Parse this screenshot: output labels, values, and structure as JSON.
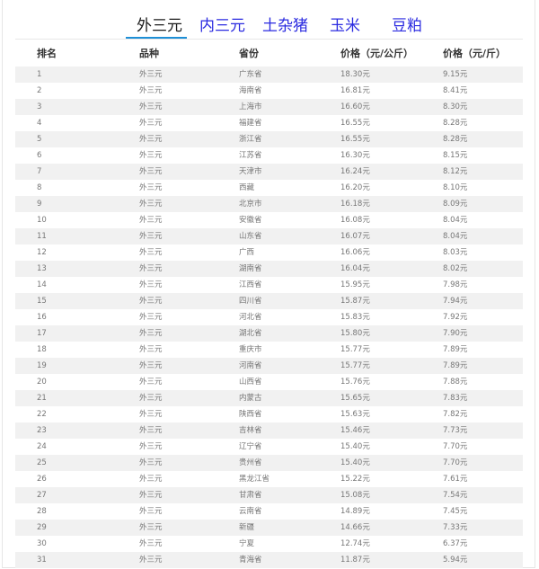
{
  "tabs": [
    {
      "label": "外三元",
      "active": true
    },
    {
      "label": "内三元",
      "active": false
    },
    {
      "label": "土杂猪",
      "active": false
    },
    {
      "label": "玉米",
      "active": false
    },
    {
      "label": "豆粕",
      "active": false
    }
  ],
  "table": {
    "headers": [
      "排名",
      "品种",
      "省份",
      "价格（元/公斤）",
      "价格（元/斤）"
    ],
    "rows": [
      [
        "1",
        "外三元",
        "广东省",
        "18.30元",
        "9.15元"
      ],
      [
        "2",
        "外三元",
        "海南省",
        "16.81元",
        "8.41元"
      ],
      [
        "3",
        "外三元",
        "上海市",
        "16.60元",
        "8.30元"
      ],
      [
        "4",
        "外三元",
        "福建省",
        "16.55元",
        "8.28元"
      ],
      [
        "5",
        "外三元",
        "浙江省",
        "16.55元",
        "8.28元"
      ],
      [
        "6",
        "外三元",
        "江苏省",
        "16.30元",
        "8.15元"
      ],
      [
        "7",
        "外三元",
        "天津市",
        "16.24元",
        "8.12元"
      ],
      [
        "8",
        "外三元",
        "西藏",
        "16.20元",
        "8.10元"
      ],
      [
        "9",
        "外三元",
        "北京市",
        "16.18元",
        "8.09元"
      ],
      [
        "10",
        "外三元",
        "安徽省",
        "16.08元",
        "8.04元"
      ],
      [
        "11",
        "外三元",
        "山东省",
        "16.07元",
        "8.04元"
      ],
      [
        "12",
        "外三元",
        "广西",
        "16.06元",
        "8.03元"
      ],
      [
        "13",
        "外三元",
        "湖南省",
        "16.04元",
        "8.02元"
      ],
      [
        "14",
        "外三元",
        "江西省",
        "15.95元",
        "7.98元"
      ],
      [
        "15",
        "外三元",
        "四川省",
        "15.87元",
        "7.94元"
      ],
      [
        "16",
        "外三元",
        "河北省",
        "15.83元",
        "7.92元"
      ],
      [
        "17",
        "外三元",
        "湖北省",
        "15.80元",
        "7.90元"
      ],
      [
        "18",
        "外三元",
        "重庆市",
        "15.77元",
        "7.89元"
      ],
      [
        "19",
        "外三元",
        "河南省",
        "15.77元",
        "7.89元"
      ],
      [
        "20",
        "外三元",
        "山西省",
        "15.76元",
        "7.88元"
      ],
      [
        "21",
        "外三元",
        "内蒙古",
        "15.65元",
        "7.83元"
      ],
      [
        "22",
        "外三元",
        "陕西省",
        "15.63元",
        "7.82元"
      ],
      [
        "23",
        "外三元",
        "吉林省",
        "15.46元",
        "7.73元"
      ],
      [
        "24",
        "外三元",
        "辽宁省",
        "15.40元",
        "7.70元"
      ],
      [
        "25",
        "外三元",
        "贵州省",
        "15.40元",
        "7.70元"
      ],
      [
        "26",
        "外三元",
        "黑龙江省",
        "15.22元",
        "7.61元"
      ],
      [
        "27",
        "外三元",
        "甘肃省",
        "15.08元",
        "7.54元"
      ],
      [
        "28",
        "外三元",
        "云南省",
        "14.89元",
        "7.45元"
      ],
      [
        "29",
        "外三元",
        "新疆",
        "14.66元",
        "7.33元"
      ],
      [
        "30",
        "外三元",
        "宁夏",
        "12.74元",
        "6.37元"
      ],
      [
        "31",
        "外三元",
        "青海省",
        "11.87元",
        "5.94元"
      ]
    ]
  },
  "colors": {
    "tab_text": "#2a2ae0",
    "tab_active_text": "#1a1a1a",
    "tab_underline": "#1e8fd6",
    "row_stripe": "#f1f1f1",
    "cell_text": "#777777"
  }
}
